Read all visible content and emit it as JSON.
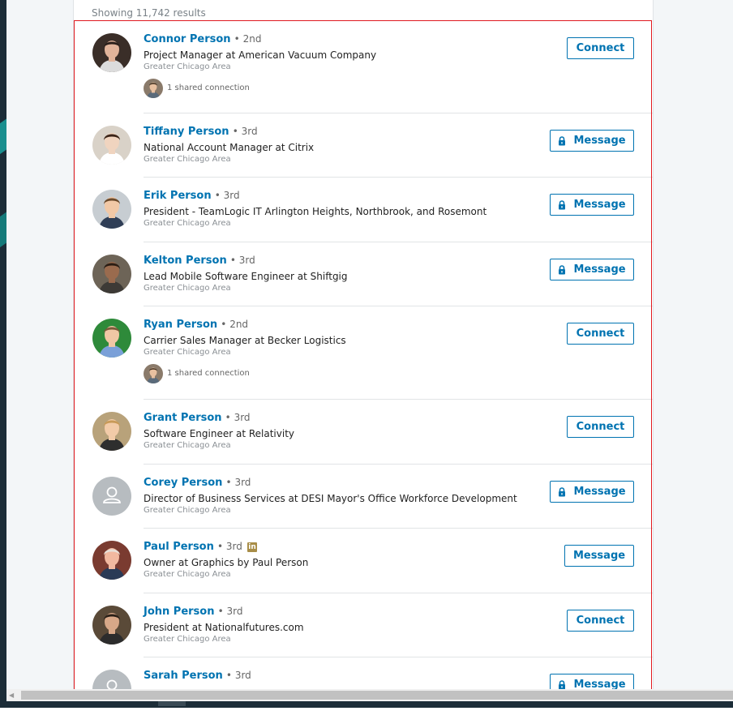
{
  "results_count": "Showing 11,742 results",
  "colors": {
    "link": "#0073b1",
    "outline": "#e0191f",
    "premium_badge": "#a88d47"
  },
  "people": [
    {
      "name": "Connor Person",
      "degree": "2nd",
      "headline": "Project Manager at American Vacuum Company",
      "location": "Greater Chicago Area",
      "shared": "1 shared connection",
      "action": "Connect",
      "avatar": "photo"
    },
    {
      "name": "Tiffany Person",
      "degree": "3rd",
      "headline": "National Account Manager at Citrix",
      "location": "Greater Chicago Area",
      "action": "Message",
      "locked": true,
      "avatar": "photo"
    },
    {
      "name": "Erik Person",
      "degree": "3rd",
      "headline": "President - TeamLogic IT Arlington Heights, Northbrook, and Rosemont",
      "location": "Greater Chicago Area",
      "action": "Message",
      "locked": true,
      "avatar": "photo"
    },
    {
      "name": "Kelton Person",
      "degree": "3rd",
      "headline": "Lead Mobile Software Engineer at Shiftgig",
      "location": "Greater Chicago Area",
      "action": "Message",
      "locked": true,
      "avatar": "photo"
    },
    {
      "name": "Ryan Person",
      "degree": "2nd",
      "headline": "Carrier Sales Manager at Becker Logistics",
      "location": "Greater Chicago Area",
      "shared": "1 shared connection",
      "action": "Connect",
      "avatar": "photo"
    },
    {
      "name": "Grant Person",
      "degree": "3rd",
      "headline": "Software Engineer at Relativity",
      "location": "Greater Chicago Area",
      "action": "Connect",
      "avatar": "photo"
    },
    {
      "name": "Corey Person",
      "degree": "3rd",
      "headline": "Director of Business Services at DESI Mayor's Office Workforce Development",
      "location": "Greater Chicago Area",
      "action": "Message",
      "locked": true,
      "avatar": "placeholder"
    },
    {
      "name": "Paul Person",
      "degree": "3rd",
      "headline": "Owner at Graphics by Paul Person",
      "location": "Greater Chicago Area",
      "action": "Message",
      "premium": true,
      "avatar": "photo"
    },
    {
      "name": "John Person",
      "degree": "3rd",
      "headline": "President at Nationalfutures.com",
      "location": "Greater Chicago Area",
      "action": "Connect",
      "avatar": "photo"
    },
    {
      "name": "Sarah Person",
      "degree": "3rd",
      "action": "Message",
      "locked": true,
      "avatar": "placeholder"
    }
  ]
}
